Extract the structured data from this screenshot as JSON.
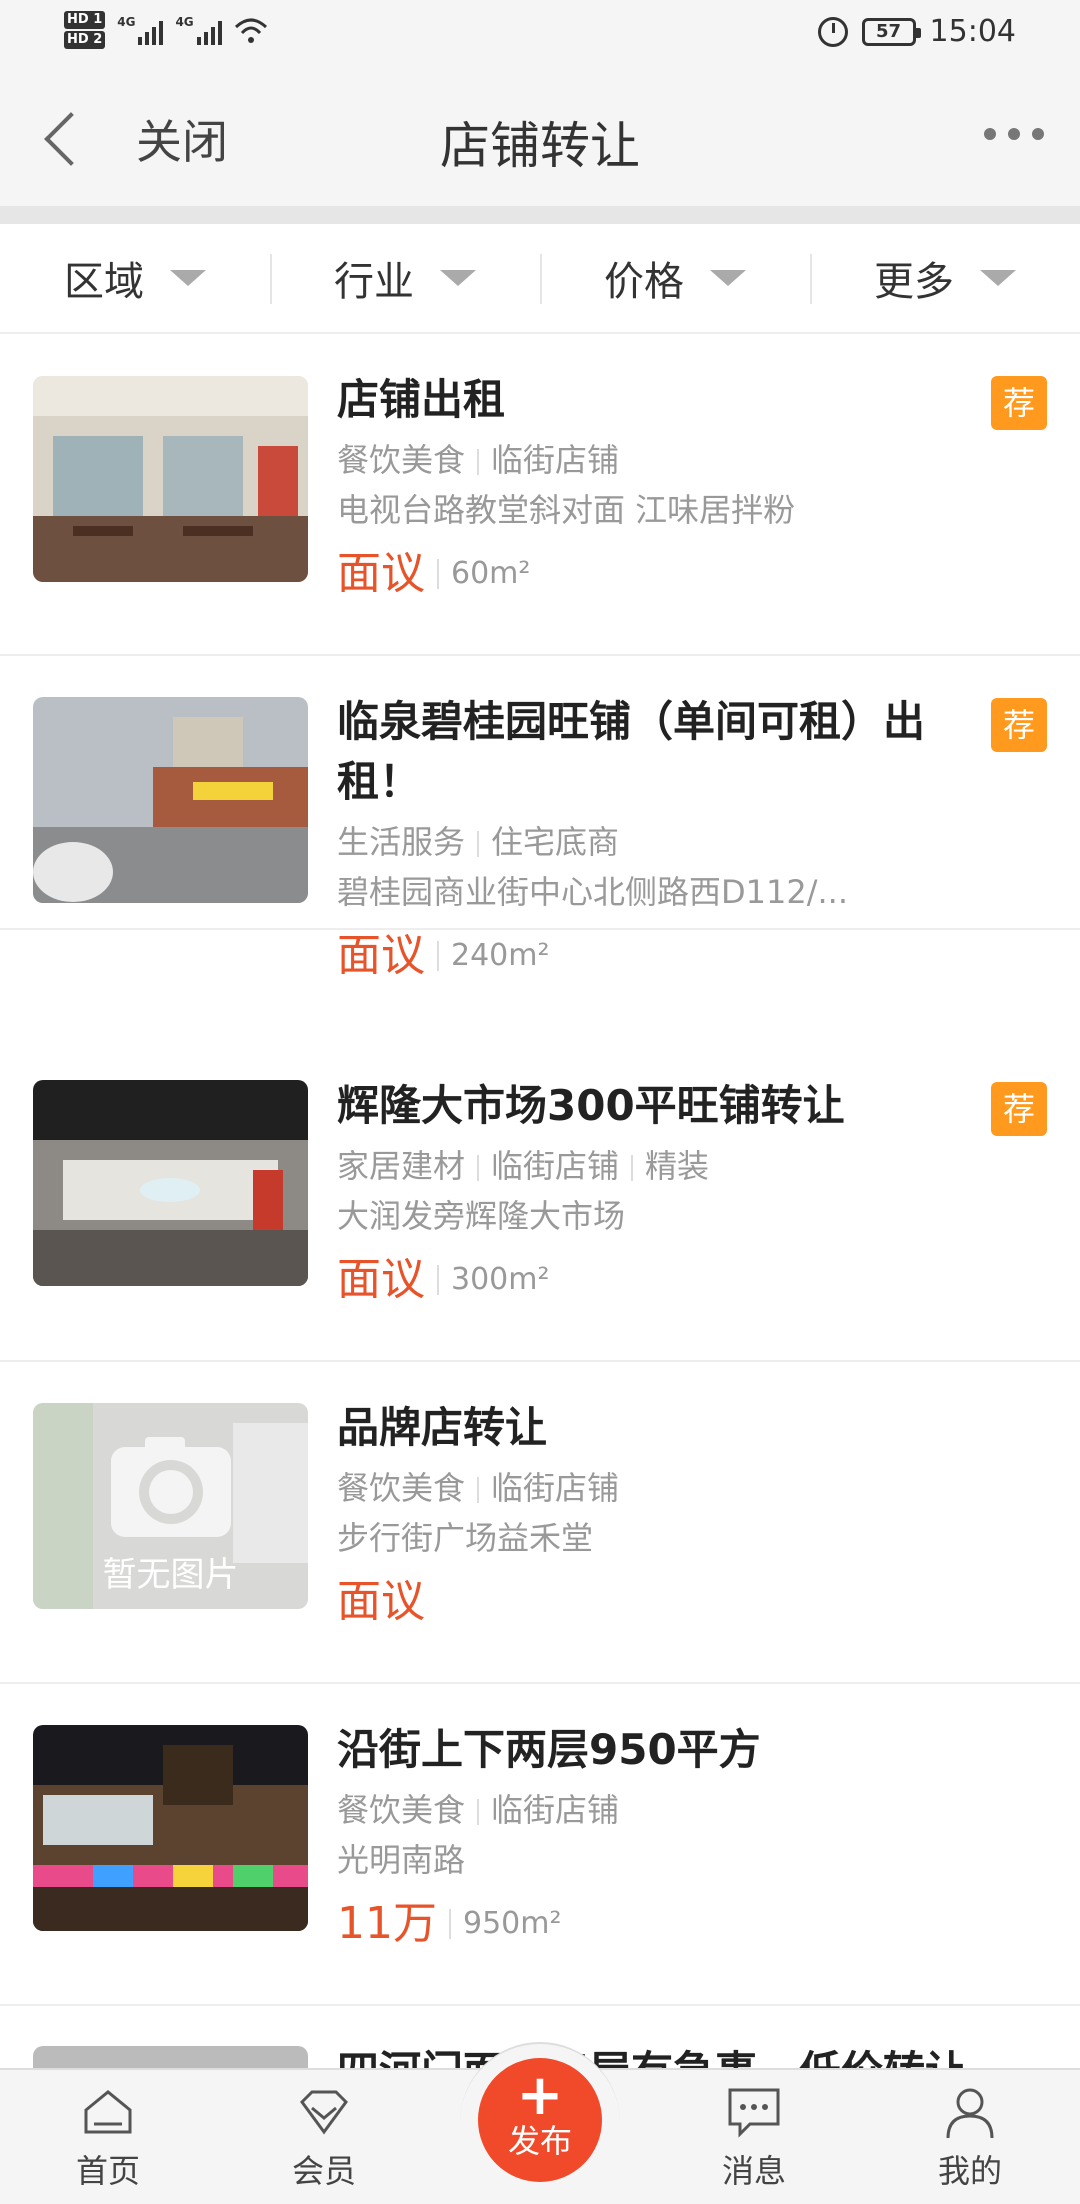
{
  "status_bar": {
    "time": "15:04",
    "battery": "57",
    "network": "4G"
  },
  "nav": {
    "close_label": "关闭",
    "title": "店铺转让"
  },
  "filters": [
    {
      "label": "区域"
    },
    {
      "label": "行业"
    },
    {
      "label": "价格"
    },
    {
      "label": "更多"
    }
  ],
  "listings": [
    {
      "title": "店铺出租",
      "tags": [
        "餐饮美食",
        "临街店铺"
      ],
      "address": "电视台路教堂斜对面 江味居拌粉",
      "price": "面议",
      "area": "60m²",
      "recommended": true,
      "badge": "荐"
    },
    {
      "title": "临泉碧桂园旺铺（单间可租）出租！",
      "tags": [
        "生活服务",
        "住宅底商"
      ],
      "address": "碧桂园商业街中心北侧路西D112/...",
      "price": "面议",
      "area": "240m²",
      "recommended": true,
      "badge": "荐"
    },
    {
      "title": "辉隆大市场300平旺铺转让",
      "tags": [
        "家居建材",
        "临街店铺",
        "精装"
      ],
      "address": "大润发旁辉隆大市场",
      "price": "面议",
      "area": "300m²",
      "recommended": true,
      "badge": "荐"
    },
    {
      "title": "品牌店转让",
      "tags": [
        "餐饮美食",
        "临街店铺"
      ],
      "address": "步行街广场益禾堂",
      "price": "面议",
      "area": "",
      "recommended": false,
      "placeholder_text": "暂无图片"
    },
    {
      "title": "沿街上下两层950平方",
      "tags": [
        "餐饮美食",
        "临街店铺"
      ],
      "address": "光明南路",
      "price": "11万",
      "area": "950m²",
      "recommended": false
    },
    {
      "title": "四河门面，房屋有急事，低价转让",
      "partial": true
    }
  ],
  "tabbar": {
    "home": "首页",
    "member": "会员",
    "publish": "发布",
    "messages": "消息",
    "mine": "我的"
  },
  "colors": {
    "accent": "#e8542a",
    "badge": "#ff9a1f",
    "publish": "#f04a2a"
  }
}
